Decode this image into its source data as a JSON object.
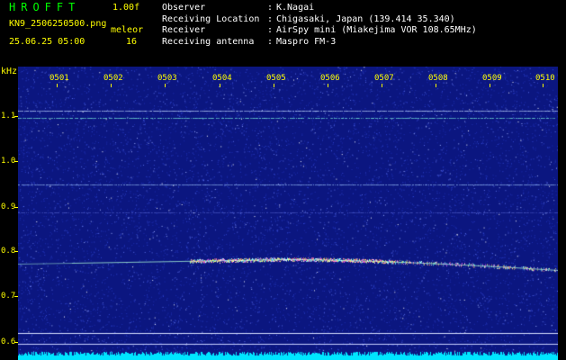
{
  "header": {
    "app_title": "HROFFT",
    "version": "1.00f",
    "filename": "KN9_2506250500.png",
    "datetime": "25.06.25 05:00",
    "mode": "meleor",
    "count": "16"
  },
  "info": [
    {
      "key": "Observer",
      "value": "K.Nagai"
    },
    {
      "key": "Receiving Location",
      "value": "Chigasaki, Japan (139.414 35.340)"
    },
    {
      "key": "Receiver",
      "value": "AirSpy mini (Miakejima VOR 108.65MHz)"
    },
    {
      "key": "Receiving antenna",
      "value": "Maspro FM-3"
    }
  ],
  "plot": {
    "unit": "kHz",
    "y_ticks": [
      "1.1",
      "1.0",
      "0.9",
      "0.8",
      "0.7",
      "0.6"
    ],
    "time_labels": [
      "0501",
      "0502",
      "0503",
      "0504",
      "0505",
      "0506",
      "0507",
      "0508",
      "0509",
      "0510"
    ],
    "colors": {
      "background": "#0b1680",
      "labels": "#ffff00",
      "signal": "#ffffff",
      "echo": "#ff66ff",
      "baseline": "#00ffff"
    }
  }
}
